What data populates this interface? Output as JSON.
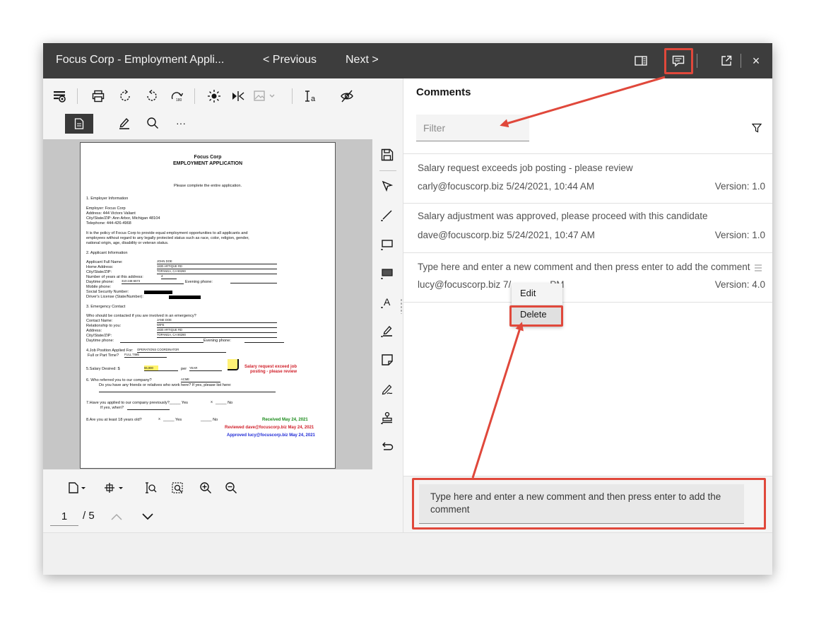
{
  "titlebar": {
    "title": "Focus Corp - Employment Appli...",
    "previous_label": "< Previous",
    "next_label": "Next >",
    "close_glyph": "×"
  },
  "toolbar": {
    "icons": [
      "highlight-eye-icon",
      "print-icon",
      "rotate-icon",
      "rotate-left-icon",
      "rotate-180-icon",
      "brightness-icon",
      "flip-icon",
      "image-icon",
      "text-icon",
      "hide-icon"
    ]
  },
  "tabs": {
    "more_label": "···"
  },
  "document": {
    "company": "Focus Corp",
    "heading": "EMPLOYMENT APPLICATION",
    "intro": "Please complete the entire application.",
    "s1": "1.      Employer Information",
    "employer": "Employer:       Focus Corp",
    "address": "Address:         444 Victors Valiant",
    "city": "City/State/ZIP:   Ann Arbor, Michigan 48104",
    "telephone": "Telephone:       444-426-4968",
    "policy1": "It is the policy of Focus Corp to provide equal employment opportunities to all applicants and",
    "policy2": "employees without regard to any legally protected status such as race, color, religion, gender,",
    "policy3": "national origin, age, disability or veteran status.",
    "s2": "2.      Applicant Information",
    "app_name": "Applicant Full Name:",
    "app_name_val": "JOHN DOE",
    "home_addr": "Home Address:",
    "home_addr_val": "1830 ARTIQUE RD",
    "app_city": "City/State/ZIP:",
    "app_city_val": "TOPANGA, CA 90290",
    "years": "Number of years at this address:",
    "years_val": "4",
    "daytime": "Daytime phone:",
    "daytime_val": "310-248-6573",
    "evening": "Evening phone:",
    "mobile": "Mobile phone:",
    "ssn": "Social Security Number:",
    "license": "Driver's License (State/Number):",
    "s3": "3.      Emergency Contact",
    "who": "Who should be contacted if you are involved in an emergency?",
    "contact": "Contact Name:",
    "contact_val": "JANE DOE",
    "relation": "Relationship to you:",
    "relation_val": "WIFE",
    "em_addr": "Address:",
    "em_addr_val": "1830 ARTIQUE RD",
    "em_city": "City/State/ZIP:",
    "em_city_val": "TOPANGA, CA 90290",
    "em_day": "Daytime phone:",
    "em_eve": "Evening phone:",
    "q4": "4.Job Position Applied For:",
    "q4_val": "OPERATIONS COORDINATOR",
    "fullpart": "Full or Part Time?",
    "fullpart_val": "FULL TIME",
    "q5": "5.Salary Desired:   $",
    "q5_val": "55,000",
    "per": "per",
    "per_val": "YEAR",
    "note1": "Salary request exceed job",
    "note2": "posting - please review",
    "q6": "6.      Who referred you to our company?",
    "q6_val": "ACME",
    "q6b": "Do you have any friends or relatives who work here? If yes, please list here:",
    "q7": "7.Have you applied to our company previously?_____ Yes",
    "q7_x": "X",
    "q7_no": "_____ No",
    "q7b": "If yes, when?",
    "q8": "8.Are you at least 18 years old?",
    "q8_x": "X",
    "q8_yes": "_____ Yes",
    "q8_no": "_____ No",
    "stamp_received": "Received May 24, 2021",
    "stamp_reviewed": "Reviewed dave@focuscorp.biz May 24, 2021",
    "stamp_approved": "Approved lucy@focuscorp.biz May 24, 2021"
  },
  "pager": {
    "current": "1",
    "total": "/ 5"
  },
  "comments": {
    "title": "Comments",
    "filter_placeholder": "Filter",
    "items": [
      {
        "text": "Salary request exceeds job posting - please review",
        "author": "carly@focuscorp.biz",
        "date": "5/24/2021, 10:44 AM",
        "version": "Version: 1.0"
      },
      {
        "text": "Salary adjustment was approved, please proceed with this candidate",
        "author": "dave@focuscorp.biz",
        "date": "5/24/2021, 10:47 AM",
        "version": "Version: 1.0"
      },
      {
        "text": "Type here and enter a new comment and then press enter to add the comment",
        "author": "lucy@focuscorp.biz",
        "date": "7/",
        "date_tail": "PM",
        "version": "Version: 4.0"
      }
    ],
    "menu": {
      "edit": "Edit",
      "delete": "Delete"
    },
    "new_comment_line1": "Type here and enter a new comment and then press enter to add the",
    "new_comment_line2": "comment"
  },
  "colors": {
    "titlebar": "#3d3d3d",
    "annotation_red": "#e0483b",
    "stamp_green": "#1a8a1a",
    "stamp_red": "#d0202a",
    "stamp_blue": "#1f2ad6",
    "sticky": "#fff176"
  }
}
